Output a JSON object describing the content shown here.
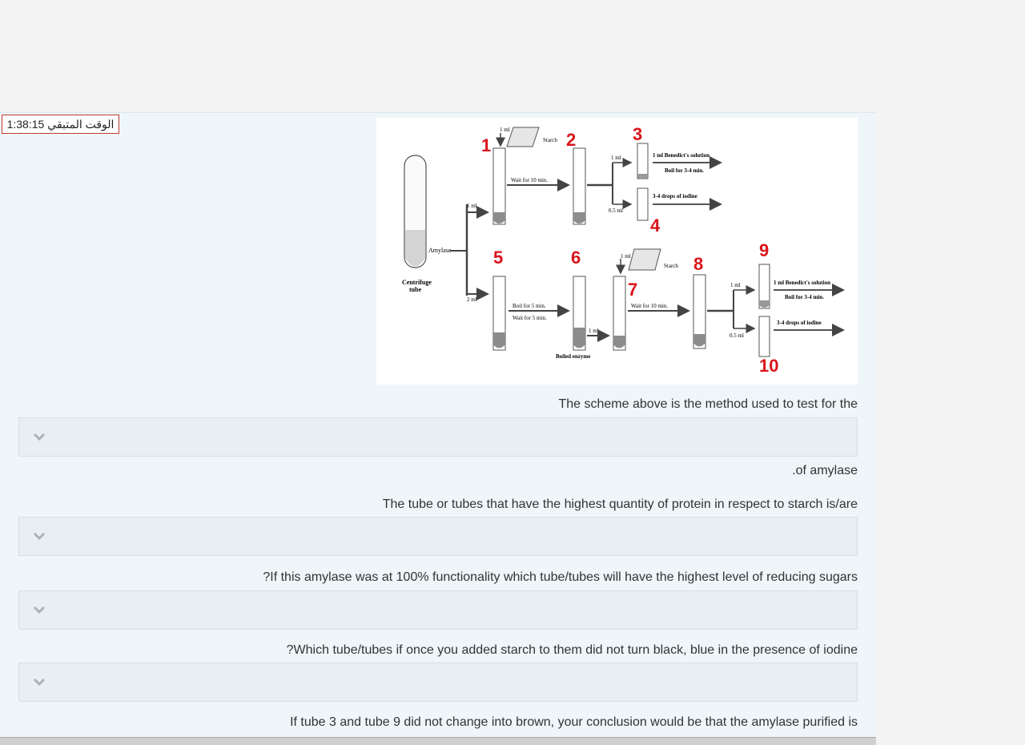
{
  "timer": {
    "label": "الوقت المتبقي",
    "value": "1:38:15"
  },
  "scheme": {
    "tube_numbers": [
      "1",
      "2",
      "3",
      "4",
      "5",
      "6",
      "7",
      "8",
      "9",
      "10"
    ],
    "labels": {
      "starch": "Starch",
      "one_ml": "1 ml",
      "two_ml": "2 ml",
      "half_ml": "0.5 ml",
      "wait10": "Wait for 10 min.",
      "benedict": "1 ml Benedict's solution",
      "boil34": "Boil for 3-4 min.",
      "iodine": "3-4 drops of iodine",
      "amylase": "Amylase",
      "centrifuge": "Centrifuge",
      "tube": "tube",
      "boil5": "Boil for 5 min.",
      "wait5": "Wait for 5 min.",
      "boiled_enzyme": "Boiled enzyme"
    }
  },
  "questions": [
    {
      "before": "The scheme above is the method used to test for the",
      "after": ".of amylase"
    },
    {
      "before": "The tube or tubes that have the highest quantity of protein in respect to starch is/are",
      "after": ""
    },
    {
      "before": "?If this amylase was at 100% functionality which tube/tubes will have the highest level of reducing sugars",
      "after": ""
    },
    {
      "before": "?Which tube/tubes if once you added starch to them did not turn black, blue in the presence of iodine",
      "after": ""
    },
    {
      "before": "If tube 3 and tube 9 did not change into brown, your conclusion would be that the amylase purified is",
      "after": ""
    }
  ],
  "colors": {
    "accent_red": "#d9141b",
    "timer_border": "#c0392b",
    "panel_bg": "#eef6f9"
  },
  "icons": {
    "dropdown": "chevron-down-icon"
  }
}
